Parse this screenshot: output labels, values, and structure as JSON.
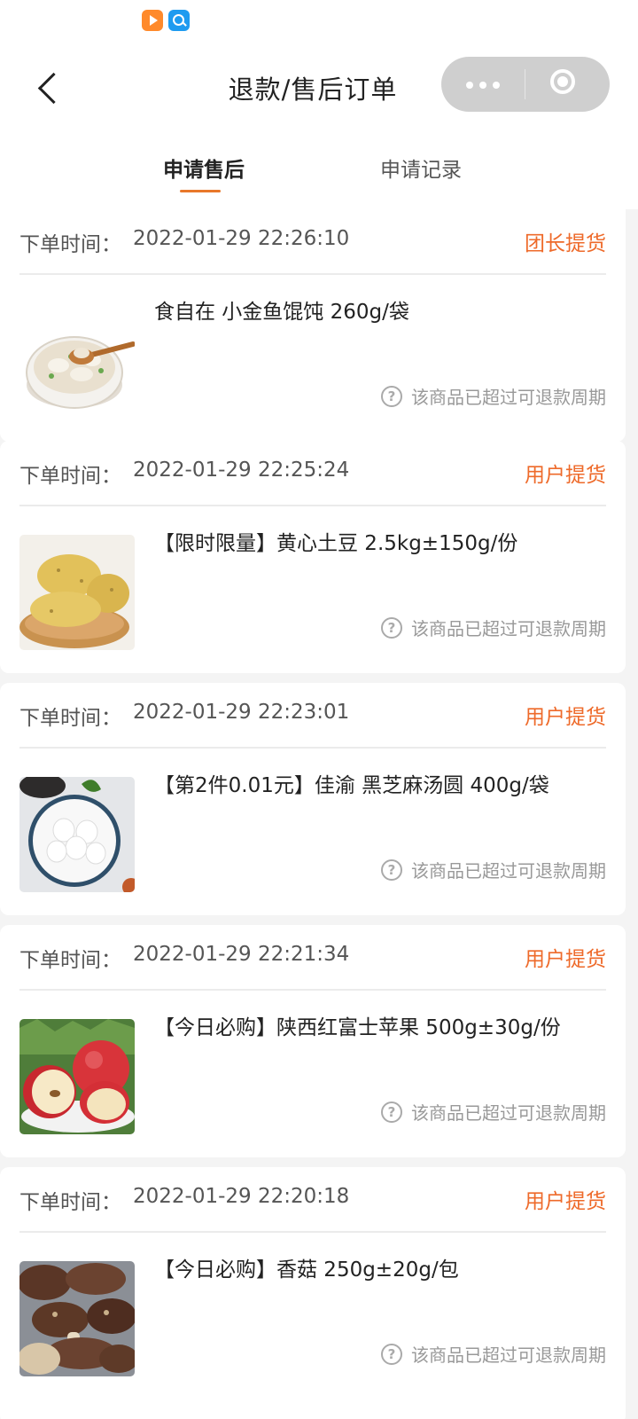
{
  "header": {
    "title": "退款/售后订单"
  },
  "tabs": [
    {
      "label": "申请售后",
      "active": true
    },
    {
      "label": "申请记录",
      "active": false
    }
  ],
  "orders": [
    {
      "time_label": "下单时间：",
      "time": "2022-01-29 22:26:10",
      "pickup_type": "团长提货",
      "item_title": "食自在 小金鱼馄饨 260g/袋",
      "notice": "该商品已超过可退款周期",
      "thumb_icon": "wonton-soup-image"
    },
    {
      "time_label": "下单时间：",
      "time": "2022-01-29 22:25:24",
      "pickup_type": "用户提货",
      "item_title": "【限时限量】黄心土豆 2.5kg±150g/份",
      "notice": "该商品已超过可退款周期",
      "thumb_icon": "potato-image"
    },
    {
      "time_label": "下单时间：",
      "time": "2022-01-29 22:23:01",
      "pickup_type": "用户提货",
      "item_title": "【第2件0.01元】佳渝 黑芝麻汤圆 400g/袋",
      "notice": "该商品已超过可退款周期",
      "thumb_icon": "tangyuan-image"
    },
    {
      "time_label": "下单时间：",
      "time": "2022-01-29 22:21:34",
      "pickup_type": "用户提货",
      "item_title": "【今日必购】陕西红富士苹果 500g±30g/份",
      "notice": "该商品已超过可退款周期",
      "thumb_icon": "apple-image"
    },
    {
      "time_label": "下单时间：",
      "time": "2022-01-29 22:20:18",
      "pickup_type": "用户提货",
      "item_title": "【今日必购】香菇 250g±20g/包",
      "notice": "该商品已超过可退款周期",
      "thumb_icon": "mushroom-image"
    }
  ],
  "colors": {
    "accent": "#ee6a2a",
    "tab_indicator": "#e8782a",
    "background": "#f4f4f4"
  }
}
